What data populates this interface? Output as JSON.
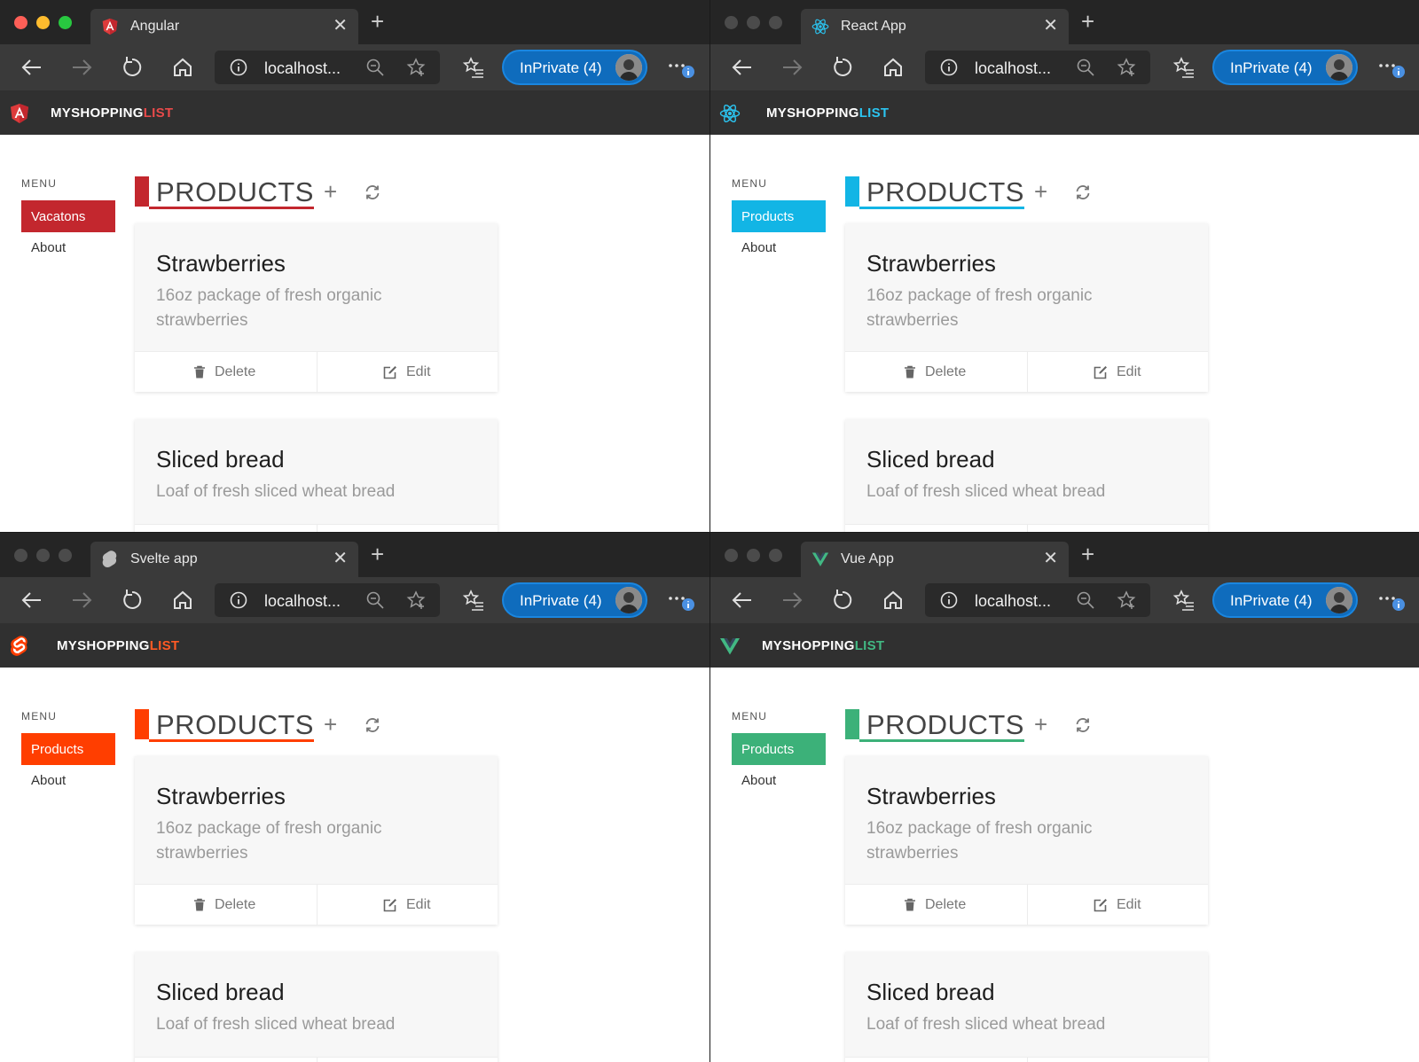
{
  "windows": [
    {
      "framework": "angular",
      "tab_title": "Angular",
      "active": true,
      "accent": "#c3272e",
      "brand_accent": "#e84a4a",
      "nav_active_label": "Vacatons"
    },
    {
      "framework": "react",
      "tab_title": "React App",
      "active": false,
      "accent": "#12b5e5",
      "brand_accent": "#2bc4f0",
      "nav_active_label": "Products"
    },
    {
      "framework": "svelte",
      "tab_title": "Svelte app",
      "active": false,
      "accent": "#ff3e00",
      "brand_accent": "#ff5a24",
      "nav_active_label": "Products"
    },
    {
      "framework": "vue",
      "tab_title": "Vue App",
      "active": false,
      "accent": "#3cb179",
      "brand_accent": "#42b883",
      "nav_active_label": "Products"
    }
  ],
  "browser": {
    "url_text": "localhost...",
    "inprivate_label": "InPrivate (4)",
    "tab_close_glyph": "✕",
    "new_tab_glyph": "+"
  },
  "app": {
    "brand_part1": "MYSHOPPING",
    "brand_part2": "LIST",
    "menu_title": "MENU",
    "nav_about": "About",
    "page_title": "PRODUCTS",
    "add_glyph": "+",
    "products": [
      {
        "name": "Strawberries",
        "description": "16oz package of fresh organic strawberries"
      },
      {
        "name": "Sliced bread",
        "description": "Loaf of fresh sliced wheat bread"
      }
    ],
    "delete_label": "Delete",
    "edit_label": "Edit"
  }
}
